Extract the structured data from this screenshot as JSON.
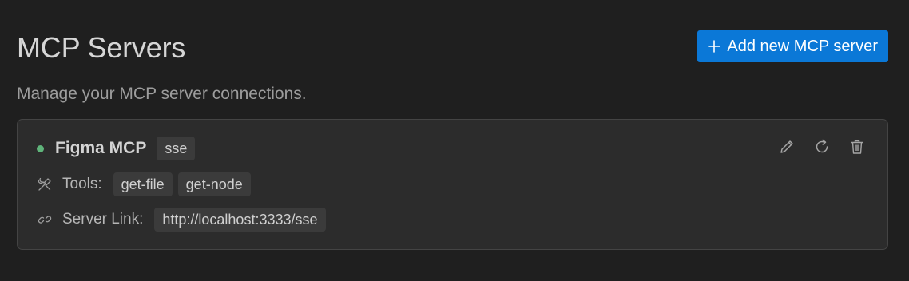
{
  "header": {
    "title": "MCP Servers",
    "add_button_label": "Add new MCP server",
    "add_button_icon": "plus-icon"
  },
  "subtitle": "Manage your MCP server connections.",
  "colors": {
    "background": "#1f1f1f",
    "card": "#2c2c2c",
    "accent": "#0b78d7",
    "status_connected": "#5fb47a"
  },
  "servers": [
    {
      "name": "Figma MCP",
      "transport": "sse",
      "status_icon": "status-dot",
      "tools_label": "Tools:",
      "tools_icon": "tools-icon",
      "tools": [
        "get-file",
        "get-node"
      ],
      "link_label": "Server Link:",
      "link_icon": "link-icon",
      "link": "http://localhost:3333/sse",
      "actions": [
        "edit-icon",
        "refresh-icon",
        "trash-icon"
      ]
    }
  ]
}
